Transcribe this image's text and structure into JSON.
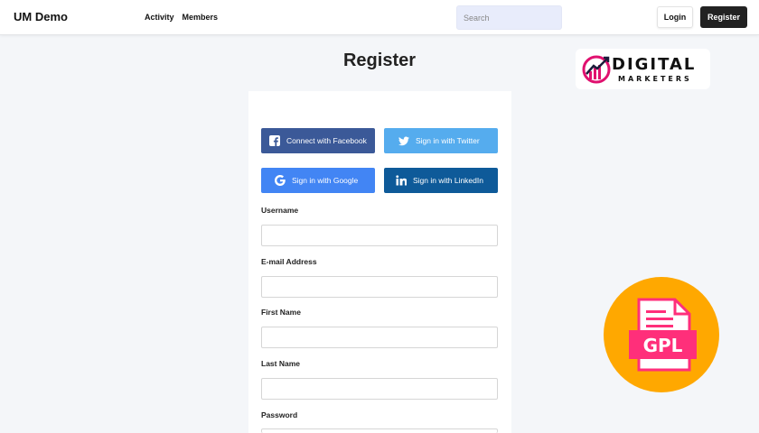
{
  "header": {
    "brand": "UM Demo",
    "nav": [
      "Activity",
      "Members"
    ],
    "search_placeholder": "Search",
    "login_label": "Login",
    "register_label": "Register"
  },
  "main": {
    "title": "Register",
    "social": {
      "facebook": "Connect with Facebook",
      "twitter": "Sign in with Twitter",
      "google": "Sign in with Google",
      "linkedin": "Sign in with LinkedIn"
    },
    "fields": [
      {
        "label": "Username",
        "value": ""
      },
      {
        "label": "E-mail Address",
        "value": ""
      },
      {
        "label": "First Name",
        "value": ""
      },
      {
        "label": "Last Name",
        "value": ""
      },
      {
        "label": "Password",
        "value": ""
      }
    ]
  },
  "overlays": {
    "logo_line1": "DIGITAL",
    "logo_line2": "MARKETERS",
    "gpl_label": "GPL"
  },
  "colors": {
    "facebook": "#3b5998",
    "twitter": "#55acee",
    "google": "#4285f4",
    "linkedin": "#0e5a99",
    "gpl_circle": "#ffa800",
    "gpl_accent": "#ff2f7a",
    "logo_accent": "#e0116f"
  },
  "icons": [
    "facebook-icon",
    "twitter-icon",
    "google-icon",
    "linkedin-icon",
    "chart-logo-icon",
    "document-icon"
  ]
}
